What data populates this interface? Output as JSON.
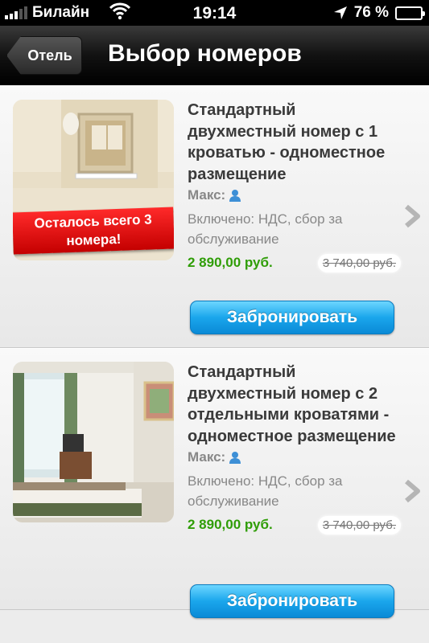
{
  "status_bar": {
    "carrier": "Билайн",
    "time": "19:14",
    "battery_percent": "76 %",
    "battery_level": 0.76
  },
  "nav": {
    "back_label": "Отель",
    "title": "Выбор номеров"
  },
  "rooms": [
    {
      "title": "Стандартный двухместный номер с 1 кроватью - одноместное размещение",
      "occupancy_label": "Макс:",
      "included": "Включено: НДС, сбор за обслуживание",
      "price": "2 890,00 руб.",
      "old_price": "3 740,00 руб.",
      "badge": "Осталось всего 3 номера!",
      "book_label": "Забронировать"
    },
    {
      "title": "Стандартный двухместный номер с 2 отдельными кроватями - одноместное размещение",
      "occupancy_label": "Макс:",
      "included": "Включено: НДС, сбор за обслуживание",
      "price": "2 890,00 руб.",
      "old_price": "3 740,00 руб.",
      "book_label": "Забронировать"
    }
  ],
  "colors": {
    "price_green": "#2f9d07",
    "badge_red": "#d80000",
    "button_blue": "#1aa6ec"
  }
}
